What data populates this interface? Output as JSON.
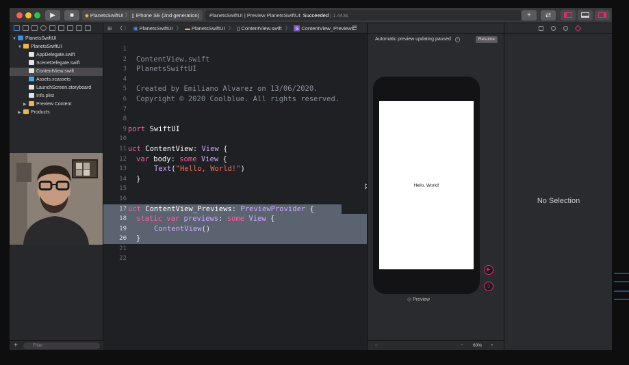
{
  "toolbar": {
    "scheme_app": "PlanetsSwiftUI",
    "scheme_device": "iPhone SE (2nd generation)",
    "status_prefix": "PlanetsSwiftUI | Preview PlanetsSwiftUI: ",
    "status_result": "Succeeded",
    "status_time": " | 1.443s",
    "run_icon": "play-icon",
    "stop_icon": "stop-icon",
    "add_label": "+",
    "swap_label": "⇄"
  },
  "navigator": {
    "items": [
      {
        "label": "PlanetsSwiftUI",
        "icon": "project-icon",
        "color": "#3a8fe8"
      },
      {
        "label": "PlanetsSwiftUI",
        "icon": "folder-icon",
        "color": "#e8b64a"
      },
      {
        "label": "AppDelegate.swift",
        "icon": "swift-file-icon",
        "color": "#e4e4e4"
      },
      {
        "label": "SceneDelegate.swift",
        "icon": "swift-file-icon",
        "color": "#e4e4e4"
      },
      {
        "label": "ContentView.swift",
        "icon": "swift-file-icon",
        "color": "#e4e4e4"
      },
      {
        "label": "Assets.xcassets",
        "icon": "assets-icon",
        "color": "#4aa5e8"
      },
      {
        "label": "LaunchScreen.storyboard",
        "icon": "storyboard-icon",
        "color": "#e4e4e4"
      },
      {
        "label": "Info.plist",
        "icon": "plist-icon",
        "color": "#e4e4e4"
      },
      {
        "label": "Preview Content",
        "icon": "folder-icon",
        "color": "#e8b64a"
      },
      {
        "label": "Products",
        "icon": "folder-icon",
        "color": "#e8b64a"
      }
    ],
    "filter_placeholder": "Filter",
    "add_label": "+"
  },
  "jumpbar": {
    "crumbs": [
      "PlanetsSwiftUI",
      "PlanetsSwiftUI",
      "ContentView.swift",
      "ContentView_Previews"
    ]
  },
  "code": {
    "lines": [
      "1",
      "2",
      "3",
      "4",
      "5",
      "6",
      "7",
      "8",
      "9",
      "10",
      "11",
      "12",
      "13",
      "14",
      "15",
      "16",
      "17",
      "18",
      "19",
      "20",
      "21",
      "22"
    ],
    "l2": "ContentView.swift",
    "l3": "PlanetsSwiftUI",
    "l5": "Created by Emiliano Alvarez on 13/06/2020.",
    "l6": "Copyright © 2020 Coolblue. All rights reserved.",
    "l9_kw": "port",
    "l9_rest": " SwiftUI",
    "l11_kw": "uct",
    "l11_name": " ContentView",
    "l11_colon": ": ",
    "l11_type": "View",
    "l11_end": " {",
    "l12_kw": "var",
    "l12_name": " body",
    "l12_colon": ": ",
    "l12_some": "some",
    "l12_type": " View",
    "l12_end": " {",
    "l13_type": "Text",
    "l13_open": "(",
    "l13_str": "\"Hello, World!\"",
    "l13_close": ")",
    "l14": "}",
    "l17_kw": "uct",
    "l17_name": " ContentView_Previews",
    "l17_colon": ": ",
    "l17_type": "PreviewProvider",
    "l17_end": " {",
    "l18_static": "static",
    "l18_var": " var",
    "l18_name": " previews",
    "l18_colon": ": ",
    "l18_some": "some",
    "l18_type": " View",
    "l18_end": " {",
    "l19_type": "ContentView",
    "l19_end": "()",
    "l20": "}"
  },
  "canvas": {
    "paused_text": "Automatic preview updating paused",
    "resume_label": "Resume",
    "hello_text": "Hello, World!",
    "preview_label": "Preview",
    "zoom": "60%"
  },
  "inspector": {
    "no_selection": "No Selection"
  }
}
